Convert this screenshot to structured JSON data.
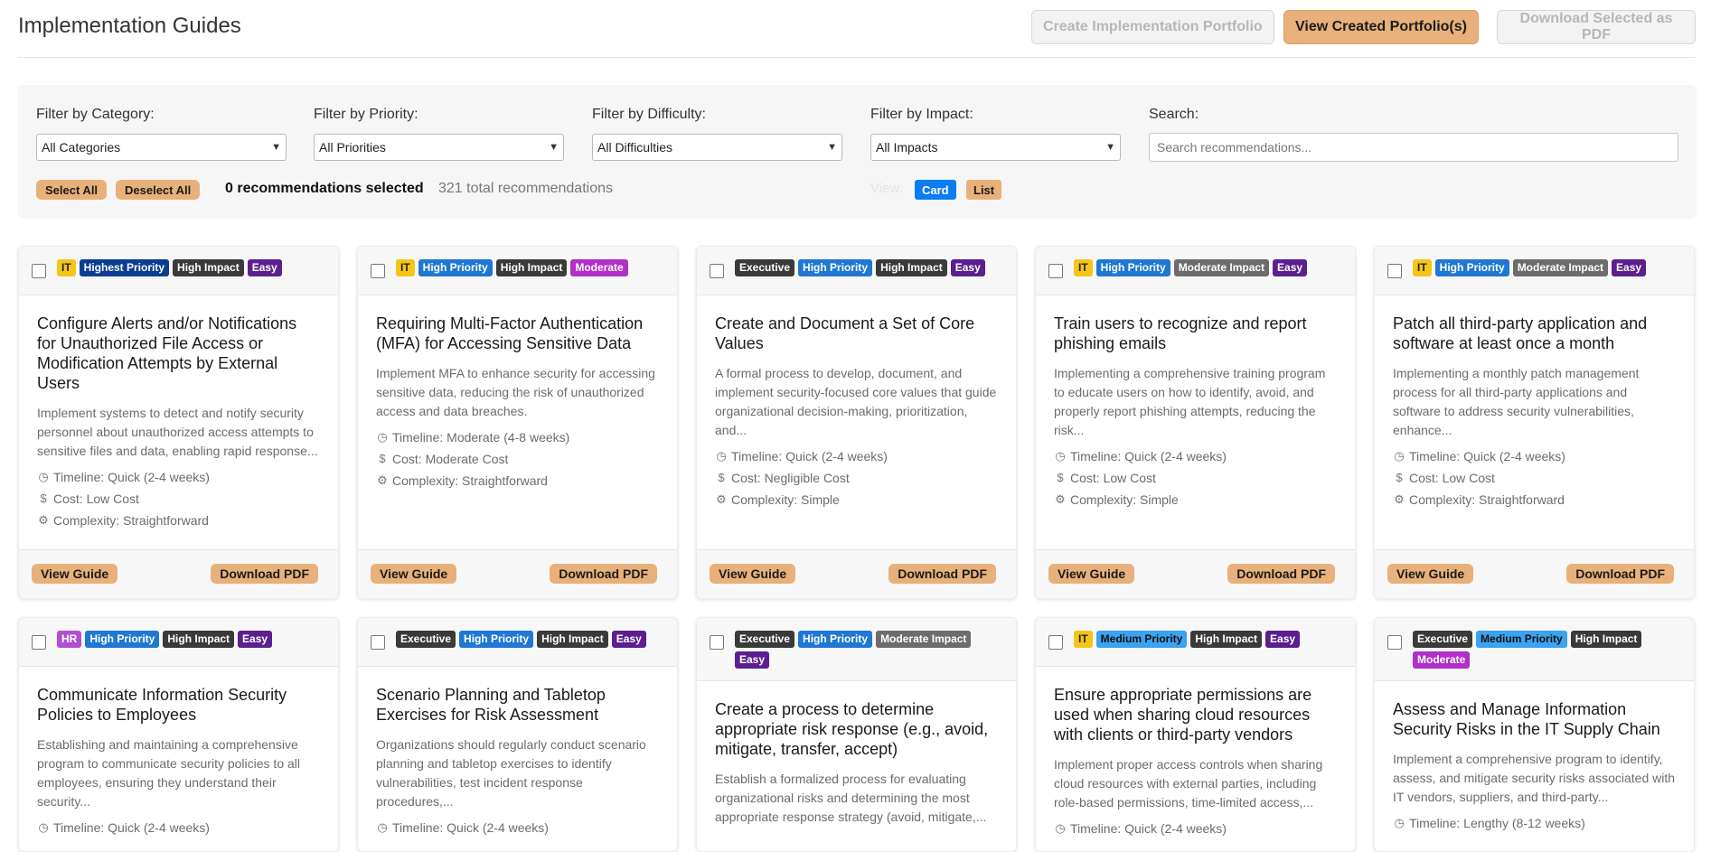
{
  "header": {
    "title": "Implementation Guides",
    "create_portfolio": "Create Implementation Portfolio",
    "view_portfolios": "View Created Portfolio(s)",
    "download_selected": "Download Selected as PDF"
  },
  "filters": {
    "category_label": "Filter by Category:",
    "category_value": "All Categories",
    "priority_label": "Filter by Priority:",
    "priority_value": "All Priorities",
    "difficulty_label": "Filter by Difficulty:",
    "difficulty_value": "All Difficulties",
    "impact_label": "Filter by Impact:",
    "impact_value": "All Impacts",
    "search_label": "Search:",
    "search_placeholder": "Search recommendations...",
    "select_all": "Select All",
    "deselect_all": "Deselect All",
    "selected_count": "0 recommendations selected",
    "total_count": "321 total recommendations",
    "view_label": "View:",
    "view_card": "Card",
    "view_list": "List"
  },
  "colors": {
    "accent": "#e8b07a",
    "active_view": "#0d7cf2",
    "badge_it": "#f5c518",
    "badge_hr": "#b04fd1",
    "badge_executive": "#3a3a3a",
    "badge_highest_priority": "#0b3d91",
    "badge_high_priority": "#1f78d1",
    "badge_medium_priority": "#3ba3f0",
    "badge_high_impact": "#3a3a3a",
    "badge_moderate_impact": "#6c6c6c",
    "badge_easy": "#5b1f8f",
    "badge_moderate": "#b030c8"
  },
  "card_actions": {
    "view_guide": "View Guide",
    "download_pdf": "Download PDF"
  },
  "cards": [
    {
      "badges": [
        {
          "text": "IT",
          "type": "it"
        },
        {
          "text": "Highest Priority",
          "type": "highest"
        },
        {
          "text": "High Impact",
          "type": "highimpact"
        },
        {
          "text": "Easy",
          "type": "easy"
        }
      ],
      "title": "Configure Alerts and/or Notifications for Unauthorized File Access or Modification Attempts by External Users",
      "description": "Implement systems to detect and notify security personnel about unauthorized access attempts to sensitive files and data, enabling rapid response...",
      "timeline": "Timeline: Quick (2-4 weeks)",
      "cost": "Cost: Low Cost",
      "complexity": "Complexity: Straightforward"
    },
    {
      "badges": [
        {
          "text": "IT",
          "type": "it"
        },
        {
          "text": "High Priority",
          "type": "high"
        },
        {
          "text": "High Impact",
          "type": "highimpact"
        },
        {
          "text": "Moderate",
          "type": "moderate"
        }
      ],
      "title": "Requiring Multi-Factor Authentication (MFA) for Accessing Sensitive Data",
      "description": "Implement MFA to enhance security for accessing sensitive data, reducing the risk of unauthorized access and data breaches.",
      "timeline": "Timeline: Moderate (4-8 weeks)",
      "cost": "Cost: Moderate Cost",
      "complexity": "Complexity: Straightforward"
    },
    {
      "badges": [
        {
          "text": "Executive",
          "type": "executive"
        },
        {
          "text": "High Priority",
          "type": "high"
        },
        {
          "text": "High Impact",
          "type": "highimpact"
        },
        {
          "text": "Easy",
          "type": "easy"
        }
      ],
      "title": "Create and Document a Set of Core Values",
      "description": "A formal process to develop, document, and implement security-focused core values that guide organizational decision-making, prioritization, and...",
      "timeline": "Timeline: Quick (2-4 weeks)",
      "cost": "Cost: Negligible Cost",
      "complexity": "Complexity: Simple"
    },
    {
      "badges": [
        {
          "text": "IT",
          "type": "it"
        },
        {
          "text": "High Priority",
          "type": "high"
        },
        {
          "text": "Moderate Impact",
          "type": "modimpact"
        },
        {
          "text": "Easy",
          "type": "easy"
        }
      ],
      "title": "Train users to recognize and report phishing emails",
      "description": "Implementing a comprehensive training program to educate users on how to identify, avoid, and properly report phishing attempts, reducing the risk...",
      "timeline": "Timeline: Quick (2-4 weeks)",
      "cost": "Cost: Low Cost",
      "complexity": "Complexity: Simple"
    },
    {
      "badges": [
        {
          "text": "IT",
          "type": "it"
        },
        {
          "text": "High Priority",
          "type": "high"
        },
        {
          "text": "Moderate Impact",
          "type": "modimpact"
        },
        {
          "text": "Easy",
          "type": "easy"
        }
      ],
      "title": "Patch all third-party application and software at least once a month",
      "description": "Implementing a monthly patch management process for all third-party applications and software to address security vulnerabilities, enhance...",
      "timeline": "Timeline: Quick (2-4 weeks)",
      "cost": "Cost: Low Cost",
      "complexity": "Complexity: Straightforward"
    },
    {
      "badges": [
        {
          "text": "HR",
          "type": "hr"
        },
        {
          "text": "High Priority",
          "type": "high"
        },
        {
          "text": "High Impact",
          "type": "highimpact"
        },
        {
          "text": "Easy",
          "type": "easy"
        }
      ],
      "title": "Communicate Information Security Policies to Employees",
      "description": "Establishing and maintaining a comprehensive program to communicate security policies to all employees, ensuring they understand their security...",
      "timeline": "Timeline: Quick (2-4 weeks)",
      "cost": "",
      "complexity": ""
    },
    {
      "badges": [
        {
          "text": "Executive",
          "type": "executive"
        },
        {
          "text": "High Priority",
          "type": "high"
        },
        {
          "text": "High Impact",
          "type": "highimpact"
        },
        {
          "text": "Easy",
          "type": "easy"
        }
      ],
      "title": "Scenario Planning and Tabletop Exercises for Risk Assessment",
      "description": "Organizations should regularly conduct scenario planning and tabletop exercises to identify vulnerabilities, test incident response procedures,...",
      "timeline": "Timeline: Quick (2-4 weeks)",
      "cost": "",
      "complexity": ""
    },
    {
      "badges": [
        {
          "text": "Executive",
          "type": "executive"
        },
        {
          "text": "High Priority",
          "type": "high"
        },
        {
          "text": "Moderate Impact",
          "type": "modimpact"
        },
        {
          "text": "Easy",
          "type": "easy"
        }
      ],
      "title": "Create a process to determine appropriate risk response (e.g., avoid, mitigate, transfer, accept)",
      "description": "Establish a formalized process for evaluating organizational risks and determining the most appropriate response strategy (avoid, mitigate,...",
      "timeline": "",
      "cost": "",
      "complexity": ""
    },
    {
      "badges": [
        {
          "text": "IT",
          "type": "it"
        },
        {
          "text": "Medium Priority",
          "type": "medium"
        },
        {
          "text": "High Impact",
          "type": "highimpact"
        },
        {
          "text": "Easy",
          "type": "easy"
        }
      ],
      "title": "Ensure appropriate permissions are used when sharing cloud resources with clients or third-party vendors",
      "description": "Implement proper access controls when sharing cloud resources with external parties, including role-based permissions, time-limited access,...",
      "timeline": "Timeline: Quick (2-4 weeks)",
      "cost": "",
      "complexity": ""
    },
    {
      "badges": [
        {
          "text": "Executive",
          "type": "executive"
        },
        {
          "text": "Medium Priority",
          "type": "medium"
        },
        {
          "text": "High Impact",
          "type": "highimpact"
        },
        {
          "text": "Moderate",
          "type": "moderate"
        }
      ],
      "title": "Assess and Manage Information Security Risks in the IT Supply Chain",
      "description": "Implement a comprehensive program to identify, assess, and mitigate security risks associated with IT vendors, suppliers, and third-party...",
      "timeline": "Timeline: Lengthy (8-12 weeks)",
      "cost": "",
      "complexity": ""
    }
  ]
}
